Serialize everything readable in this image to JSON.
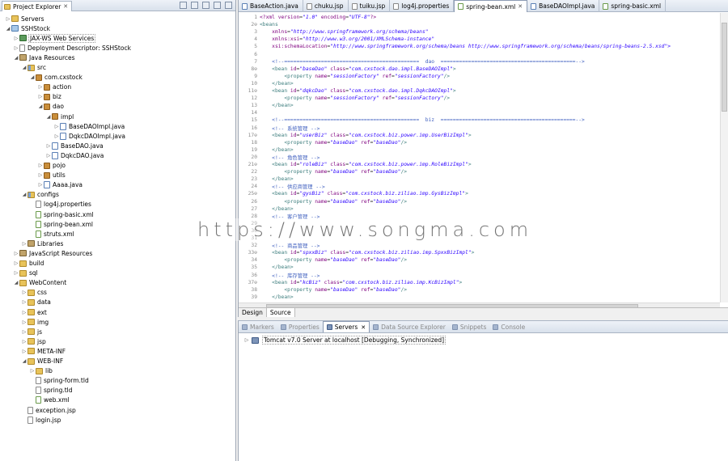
{
  "explorer": {
    "title": "Project Explorer",
    "close_label": "✕",
    "tree": [
      {
        "label": "Servers",
        "depth": 0,
        "twisty": "▷",
        "icon": "folder"
      },
      {
        "label": "SSHStock",
        "depth": 0,
        "twisty": "◢",
        "icon": "project"
      },
      {
        "label": "JAX-WS Web Services",
        "depth": 1,
        "twisty": "▷",
        "icon": "ws",
        "selected": true
      },
      {
        "label": "Deployment Descriptor: SSHStock",
        "depth": 1,
        "twisty": "▷",
        "icon": "file"
      },
      {
        "label": "Java Resources",
        "depth": 1,
        "twisty": "◢",
        "icon": "lib"
      },
      {
        "label": "src",
        "depth": 2,
        "twisty": "◢",
        "icon": "srcfolder"
      },
      {
        "label": "com.cxstock",
        "depth": 3,
        "twisty": "◢",
        "icon": "pkg"
      },
      {
        "label": "action",
        "depth": 4,
        "twisty": "▷",
        "icon": "pkg"
      },
      {
        "label": "biz",
        "depth": 4,
        "twisty": "▷",
        "icon": "pkg"
      },
      {
        "label": "dao",
        "depth": 4,
        "twisty": "◢",
        "icon": "pkg"
      },
      {
        "label": "impl",
        "depth": 5,
        "twisty": "◢",
        "icon": "pkg"
      },
      {
        "label": "BaseDAOImpl.java",
        "depth": 6,
        "twisty": "▷",
        "icon": "java"
      },
      {
        "label": "DqkcDAOImpl.java",
        "depth": 6,
        "twisty": "▷",
        "icon": "java"
      },
      {
        "label": "BaseDAO.java",
        "depth": 5,
        "twisty": "▷",
        "icon": "java"
      },
      {
        "label": "DqkcDAO.java",
        "depth": 5,
        "twisty": "▷",
        "icon": "java"
      },
      {
        "label": "pojo",
        "depth": 4,
        "twisty": "▷",
        "icon": "pkg"
      },
      {
        "label": "utils",
        "depth": 4,
        "twisty": "▷",
        "icon": "pkg"
      },
      {
        "label": "Aaaa.java",
        "depth": 4,
        "twisty": "▷",
        "icon": "java"
      },
      {
        "label": "configs",
        "depth": 2,
        "twisty": "◢",
        "icon": "srcfolder"
      },
      {
        "label": "log4j.properties",
        "depth": 3,
        "twisty": "",
        "icon": "file"
      },
      {
        "label": "spring-basic.xml",
        "depth": 3,
        "twisty": "",
        "icon": "xml"
      },
      {
        "label": "spring-bean.xml",
        "depth": 3,
        "twisty": "",
        "icon": "xml"
      },
      {
        "label": "struts.xml",
        "depth": 3,
        "twisty": "",
        "icon": "xml"
      },
      {
        "label": "Libraries",
        "depth": 2,
        "twisty": "▷",
        "icon": "lib"
      },
      {
        "label": "JavaScript Resources",
        "depth": 1,
        "twisty": "▷",
        "icon": "lib"
      },
      {
        "label": "build",
        "depth": 1,
        "twisty": "▷",
        "icon": "folder"
      },
      {
        "label": "sql",
        "depth": 1,
        "twisty": "▷",
        "icon": "folder"
      },
      {
        "label": "WebContent",
        "depth": 1,
        "twisty": "◢",
        "icon": "folder"
      },
      {
        "label": "css",
        "depth": 2,
        "twisty": "▷",
        "icon": "folder"
      },
      {
        "label": "data",
        "depth": 2,
        "twisty": "▷",
        "icon": "folder"
      },
      {
        "label": "ext",
        "depth": 2,
        "twisty": "▷",
        "icon": "folder"
      },
      {
        "label": "img",
        "depth": 2,
        "twisty": "▷",
        "icon": "folder"
      },
      {
        "label": "js",
        "depth": 2,
        "twisty": "▷",
        "icon": "folder"
      },
      {
        "label": "jsp",
        "depth": 2,
        "twisty": "▷",
        "icon": "folder"
      },
      {
        "label": "META-INF",
        "depth": 2,
        "twisty": "▷",
        "icon": "folder"
      },
      {
        "label": "WEB-INF",
        "depth": 2,
        "twisty": "◢",
        "icon": "folder"
      },
      {
        "label": "lib",
        "depth": 3,
        "twisty": "▷",
        "icon": "folder"
      },
      {
        "label": "spring-form.tld",
        "depth": 3,
        "twisty": "",
        "icon": "file"
      },
      {
        "label": "spring.tld",
        "depth": 3,
        "twisty": "",
        "icon": "file"
      },
      {
        "label": "web.xml",
        "depth": 3,
        "twisty": "",
        "icon": "xml"
      },
      {
        "label": "exception.jsp",
        "depth": 2,
        "twisty": "",
        "icon": "file"
      },
      {
        "label": "login.jsp",
        "depth": 2,
        "twisty": "",
        "icon": "file"
      }
    ]
  },
  "editor": {
    "tabs": [
      {
        "label": "BaseAction.java",
        "icon": "java",
        "active": false
      },
      {
        "label": "chuku.jsp",
        "icon": "file",
        "active": false
      },
      {
        "label": "tuiku.jsp",
        "icon": "file",
        "active": false
      },
      {
        "label": "log4j.properties",
        "icon": "file",
        "active": false
      },
      {
        "label": "spring-bean.xml",
        "icon": "xml",
        "active": true
      },
      {
        "label": "BaseDAOImpl.java",
        "icon": "java",
        "active": false
      },
      {
        "label": "spring-basic.xml",
        "icon": "xml",
        "active": false
      }
    ],
    "close_label": "✕",
    "lines": [
      {
        "n": "1",
        "parts": [
          [
            "pi",
            "<?xml "
          ],
          [
            "attr",
            "version"
          ],
          [
            "ct",
            "="
          ],
          [
            "val",
            "\"1.0\" "
          ],
          [
            "attr",
            "encoding"
          ],
          [
            "ct",
            "="
          ],
          [
            "val",
            "\"UTF-8\""
          ],
          [
            "pi",
            "?>"
          ]
        ]
      },
      {
        "n": "2⊖",
        "parts": [
          [
            "tag",
            "<beans"
          ]
        ]
      },
      {
        "n": "3",
        "parts": [
          [
            "ct",
            "    "
          ],
          [
            "attr",
            "xmlns"
          ],
          [
            "ct",
            "="
          ],
          [
            "val",
            "\"http://www.springframework.org/schema/beans\""
          ]
        ]
      },
      {
        "n": "4",
        "parts": [
          [
            "ct",
            "    "
          ],
          [
            "attr",
            "xmlns:xsi"
          ],
          [
            "ct",
            "="
          ],
          [
            "val",
            "\"http://www.w3.org/2001/XMLSchema-instance\""
          ]
        ]
      },
      {
        "n": "5",
        "parts": [
          [
            "ct",
            "    "
          ],
          [
            "attr",
            "xsi:schemaLocation"
          ],
          [
            "ct",
            "="
          ],
          [
            "val",
            "\"http://www.springframework.org/schema/beans http://www.springframework.org/schema/beans/spring-beans-2.5.xsd\">"
          ]
        ]
      },
      {
        "n": "6",
        "parts": []
      },
      {
        "n": "7",
        "parts": [
          [
            "cmt",
            "    <!--============================================  dao  ============================================-->"
          ]
        ]
      },
      {
        "n": "8⊖",
        "parts": [
          [
            "tag",
            "    <bean "
          ],
          [
            "attr",
            "id"
          ],
          [
            "ct",
            "="
          ],
          [
            "val",
            "\"baseDao\" "
          ],
          [
            "attr",
            "class"
          ],
          [
            "ct",
            "="
          ],
          [
            "val",
            "\"com.cxstock.dao.impl.BaseDAOImpl\""
          ],
          [
            "tag",
            ">"
          ]
        ]
      },
      {
        "n": "9",
        "parts": [
          [
            "tag",
            "        <property "
          ],
          [
            "attr",
            "name"
          ],
          [
            "ct",
            "="
          ],
          [
            "val",
            "\"sessionFactory\" "
          ],
          [
            "attr",
            "ref"
          ],
          [
            "ct",
            "="
          ],
          [
            "val",
            "\"sessionFactory\""
          ],
          [
            "tag",
            "/>"
          ]
        ]
      },
      {
        "n": "10",
        "parts": [
          [
            "tag",
            "    </bean>"
          ]
        ]
      },
      {
        "n": "11⊖",
        "parts": [
          [
            "tag",
            "    <bean "
          ],
          [
            "attr",
            "id"
          ],
          [
            "ct",
            "="
          ],
          [
            "val",
            "\"dqkcDao\" "
          ],
          [
            "attr",
            "class"
          ],
          [
            "ct",
            "="
          ],
          [
            "val",
            "\"com.cxstock.dao.impl.DqkcDAOImpl\""
          ],
          [
            "tag",
            ">"
          ]
        ]
      },
      {
        "n": "12",
        "parts": [
          [
            "tag",
            "        <property "
          ],
          [
            "attr",
            "name"
          ],
          [
            "ct",
            "="
          ],
          [
            "val",
            "\"sessionFactory\" "
          ],
          [
            "attr",
            "ref"
          ],
          [
            "ct",
            "="
          ],
          [
            "val",
            "\"sessionFactory\""
          ],
          [
            "tag",
            "/>"
          ]
        ]
      },
      {
        "n": "13",
        "parts": [
          [
            "tag",
            "    </bean>"
          ]
        ]
      },
      {
        "n": "14",
        "parts": []
      },
      {
        "n": "15",
        "parts": [
          [
            "cmt",
            "    <!--============================================  biz  ============================================-->"
          ]
        ]
      },
      {
        "n": "16",
        "parts": [
          [
            "cmt",
            "    <!-- 系统管理 -->"
          ]
        ]
      },
      {
        "n": "17⊖",
        "parts": [
          [
            "tag",
            "    <bean "
          ],
          [
            "attr",
            "id"
          ],
          [
            "ct",
            "="
          ],
          [
            "val",
            "\"userBiz\" "
          ],
          [
            "attr",
            "class"
          ],
          [
            "ct",
            "="
          ],
          [
            "val",
            "\"com.cxstock.biz.power.imp.UserBizImpl\""
          ],
          [
            "tag",
            ">"
          ]
        ]
      },
      {
        "n": "18",
        "parts": [
          [
            "tag",
            "        <property "
          ],
          [
            "attr",
            "name"
          ],
          [
            "ct",
            "="
          ],
          [
            "val",
            "\"baseDao\" "
          ],
          [
            "attr",
            "ref"
          ],
          [
            "ct",
            "="
          ],
          [
            "val",
            "\"baseDao\""
          ],
          [
            "tag",
            "/>"
          ]
        ]
      },
      {
        "n": "19",
        "parts": [
          [
            "tag",
            "    </bean>"
          ]
        ]
      },
      {
        "n": "20",
        "parts": [
          [
            "cmt",
            "    <!-- 角色管理 -->"
          ]
        ]
      },
      {
        "n": "21⊖",
        "parts": [
          [
            "tag",
            "    <bean "
          ],
          [
            "attr",
            "id"
          ],
          [
            "ct",
            "="
          ],
          [
            "val",
            "\"roleBiz\" "
          ],
          [
            "attr",
            "class"
          ],
          [
            "ct",
            "="
          ],
          [
            "val",
            "\"com.cxstock.biz.power.imp.RoleBizImpl\""
          ],
          [
            "tag",
            ">"
          ]
        ]
      },
      {
        "n": "22",
        "parts": [
          [
            "tag",
            "        <property "
          ],
          [
            "attr",
            "name"
          ],
          [
            "ct",
            "="
          ],
          [
            "val",
            "\"baseDao\" "
          ],
          [
            "attr",
            "ref"
          ],
          [
            "ct",
            "="
          ],
          [
            "val",
            "\"baseDao\""
          ],
          [
            "tag",
            "/>"
          ]
        ]
      },
      {
        "n": "23",
        "parts": [
          [
            "tag",
            "    </bean>"
          ]
        ]
      },
      {
        "n": "24",
        "parts": [
          [
            "cmt",
            "    <!-- 供应商管理 -->"
          ]
        ]
      },
      {
        "n": "25⊖",
        "parts": [
          [
            "tag",
            "    <bean "
          ],
          [
            "attr",
            "id"
          ],
          [
            "ct",
            "="
          ],
          [
            "val",
            "\"gysBiz\" "
          ],
          [
            "attr",
            "class"
          ],
          [
            "ct",
            "="
          ],
          [
            "val",
            "\"com.cxstock.biz.ziliao.imp.GysBizImpl\""
          ],
          [
            "tag",
            ">"
          ]
        ]
      },
      {
        "n": "26",
        "parts": [
          [
            "tag",
            "        <property "
          ],
          [
            "attr",
            "name"
          ],
          [
            "ct",
            "="
          ],
          [
            "val",
            "\"baseDao\" "
          ],
          [
            "attr",
            "ref"
          ],
          [
            "ct",
            "="
          ],
          [
            "val",
            "\"baseDao\""
          ],
          [
            "tag",
            "/>"
          ]
        ]
      },
      {
        "n": "27",
        "parts": [
          [
            "tag",
            "    </bean>"
          ]
        ]
      },
      {
        "n": "28",
        "parts": [
          [
            "cmt",
            "    <!-- 客户管理 -->"
          ]
        ]
      },
      {
        "n": "29",
        "parts": []
      },
      {
        "n": "30",
        "parts": []
      },
      {
        "n": "31",
        "parts": []
      },
      {
        "n": "32",
        "parts": [
          [
            "cmt",
            "    <!-- 商品管理 -->"
          ]
        ]
      },
      {
        "n": "33⊖",
        "parts": [
          [
            "tag",
            "    <bean "
          ],
          [
            "attr",
            "id"
          ],
          [
            "ct",
            "="
          ],
          [
            "val",
            "\"spxxBiz\" "
          ],
          [
            "attr",
            "class"
          ],
          [
            "ct",
            "="
          ],
          [
            "val",
            "\"com.cxstock.biz.ziliao.imp.SpxxBizImpl\""
          ],
          [
            "tag",
            ">"
          ]
        ]
      },
      {
        "n": "34",
        "parts": [
          [
            "tag",
            "        <property "
          ],
          [
            "attr",
            "name"
          ],
          [
            "ct",
            "="
          ],
          [
            "val",
            "\"baseDao\" "
          ],
          [
            "attr",
            "ref"
          ],
          [
            "ct",
            "="
          ],
          [
            "val",
            "\"baseDao\""
          ],
          [
            "tag",
            "/>"
          ]
        ]
      },
      {
        "n": "35",
        "parts": [
          [
            "tag",
            "    </bean>"
          ]
        ]
      },
      {
        "n": "36",
        "parts": [
          [
            "cmt",
            "    <!-- 库存管理 -->"
          ]
        ]
      },
      {
        "n": "37⊖",
        "parts": [
          [
            "tag",
            "    <bean "
          ],
          [
            "attr",
            "id"
          ],
          [
            "ct",
            "="
          ],
          [
            "val",
            "\"kcBiz\" "
          ],
          [
            "attr",
            "class"
          ],
          [
            "ct",
            "="
          ],
          [
            "val",
            "\"com.cxstock.biz.ziliao.imp.KcBizImpl\""
          ],
          [
            "tag",
            ">"
          ]
        ]
      },
      {
        "n": "38",
        "parts": [
          [
            "tag",
            "        <property "
          ],
          [
            "attr",
            "name"
          ],
          [
            "ct",
            "="
          ],
          [
            "val",
            "\"baseDao\" "
          ],
          [
            "attr",
            "ref"
          ],
          [
            "ct",
            "="
          ],
          [
            "val",
            "\"baseDao\""
          ],
          [
            "tag",
            "/>"
          ]
        ]
      },
      {
        "n": "39",
        "parts": [
          [
            "tag",
            "    </bean>"
          ]
        ]
      }
    ],
    "design_label": "Design",
    "source_label": "Source"
  },
  "bottom": {
    "tabs": [
      {
        "label": "Markers",
        "active": false
      },
      {
        "label": "Properties",
        "active": false
      },
      {
        "label": "Servers",
        "active": true
      },
      {
        "label": "Data Source Explorer",
        "active": false
      },
      {
        "label": "Snippets",
        "active": false
      },
      {
        "label": "Console",
        "active": false
      }
    ],
    "server_label": "Tomcat v7.0 Server at localhost  [Debugging, Synchronized]"
  },
  "watermark": "https://www.songma.com"
}
